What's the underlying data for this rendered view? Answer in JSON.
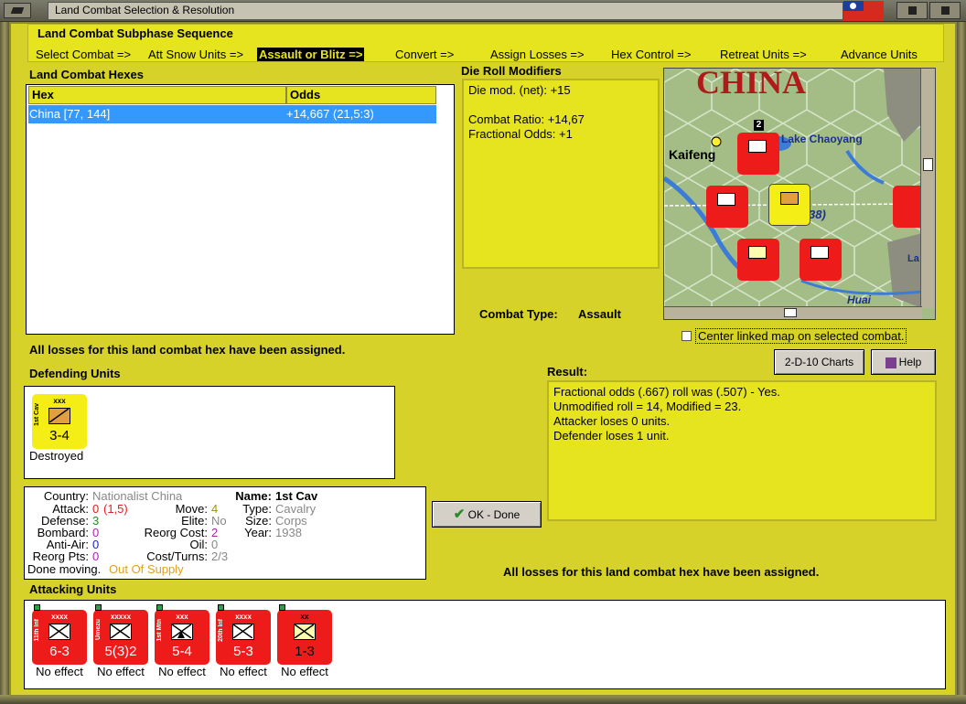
{
  "window": {
    "title": "Land Combat Selection & Resolution"
  },
  "subphase": {
    "header": "Land Combat Subphase Sequence",
    "steps": [
      "Select Combat =>",
      "Att Snow Units =>",
      "Assault or Blitz =>",
      "Convert =>",
      "Assign Losses =>",
      "Hex Control =>",
      "Retreat Units =>",
      "Advance Units"
    ],
    "active": "Assault or Blitz =>"
  },
  "hexes": {
    "header": "Land Combat Hexes",
    "columns": [
      "Hex",
      "Odds"
    ],
    "rows": [
      {
        "hex": "China [77, 144]",
        "odds": "+14,667 (21,5:3)"
      }
    ]
  },
  "die": {
    "header": "Die Roll Modifiers",
    "line1": "Die mod. (net): +15",
    "line2": "Combat Ratio: +14,67",
    "line3": "Fractional Odds: +1"
  },
  "map": {
    "country_label": "CHINA",
    "lake": "Lake Chaoyang",
    "city": "Kaifeng",
    "river": "Huai",
    "partial_value": "38)",
    "partial_label": "La",
    "stack_count": "2"
  },
  "combat_type": {
    "label": "Combat Type:",
    "value": "Assault"
  },
  "center_map": {
    "label": "Center linked map on selected combat.",
    "checked": false
  },
  "status_losses": "All losses for this land combat hex have been assigned.",
  "defending": {
    "header": "Defending Units",
    "units": [
      {
        "size": "xxx",
        "name": "1st Cav",
        "strength": "3-4",
        "status": "Destroyed"
      }
    ]
  },
  "details": {
    "country_label": "Country:",
    "country": "Nationalist China",
    "attack_label": "Attack:",
    "attack": "0",
    "attack_extra": "(1,5)",
    "defense_label": "Defense:",
    "defense": "3",
    "bombard_label": "Bombard:",
    "bombard": "0",
    "antiair_label": "Anti-Air:",
    "antiair": "0",
    "reorg_label": "Reorg Pts:",
    "reorg": "0",
    "move_label": "Move:",
    "move": "4",
    "elite_label": "Elite:",
    "elite": "No",
    "reorg_cost_label": "Reorg Cost:",
    "reorg_cost": "2",
    "oil_label": "Oil:",
    "oil": "0",
    "cost_label": "Cost/Turns:",
    "cost": "2/3",
    "name_label": "Name:",
    "name": "1st Cav",
    "type_label": "Type:",
    "type": "Cavalry",
    "size_label": "Size:",
    "size": "Corps",
    "year_label": "Year:",
    "year": "1938",
    "done": "Done moving.",
    "supply": "Out Of Supply"
  },
  "buttons": {
    "charts": "2-D-10 Charts",
    "help": "Help",
    "ok": "OK - Done"
  },
  "result": {
    "header": "Result:",
    "lines": [
      "Fractional odds (.667) roll was (.507)  - Yes.",
      "Unmodified roll = 14, Modified = 23.",
      "Attacker loses 0 units.",
      "Defender loses 1 unit."
    ]
  },
  "attacking": {
    "header": "Attacking Units",
    "units": [
      {
        "size": "xxxx",
        "name": "11th Inf",
        "strength": "6-3",
        "status": "No effect",
        "color": "red"
      },
      {
        "size": "xxxxx",
        "name": "Umezu",
        "strength": "5(3)2",
        "status": "No effect",
        "color": "red"
      },
      {
        "size": "xxx",
        "name": "1st Mtn",
        "strength": "5-4",
        "status": "No effect",
        "color": "red"
      },
      {
        "size": "xxxx",
        "name": "20th Inf",
        "strength": "5-3",
        "status": "No effect",
        "color": "red"
      },
      {
        "size": "xx",
        "name": "",
        "strength": "1-3",
        "status": "No effect",
        "color": "red"
      }
    ]
  },
  "colors": {
    "panel_yellow": "#e6e31f",
    "japan_red": "#ee1b1b",
    "china_yellow": "#f5ee16",
    "selection_blue": "#3399ff"
  }
}
